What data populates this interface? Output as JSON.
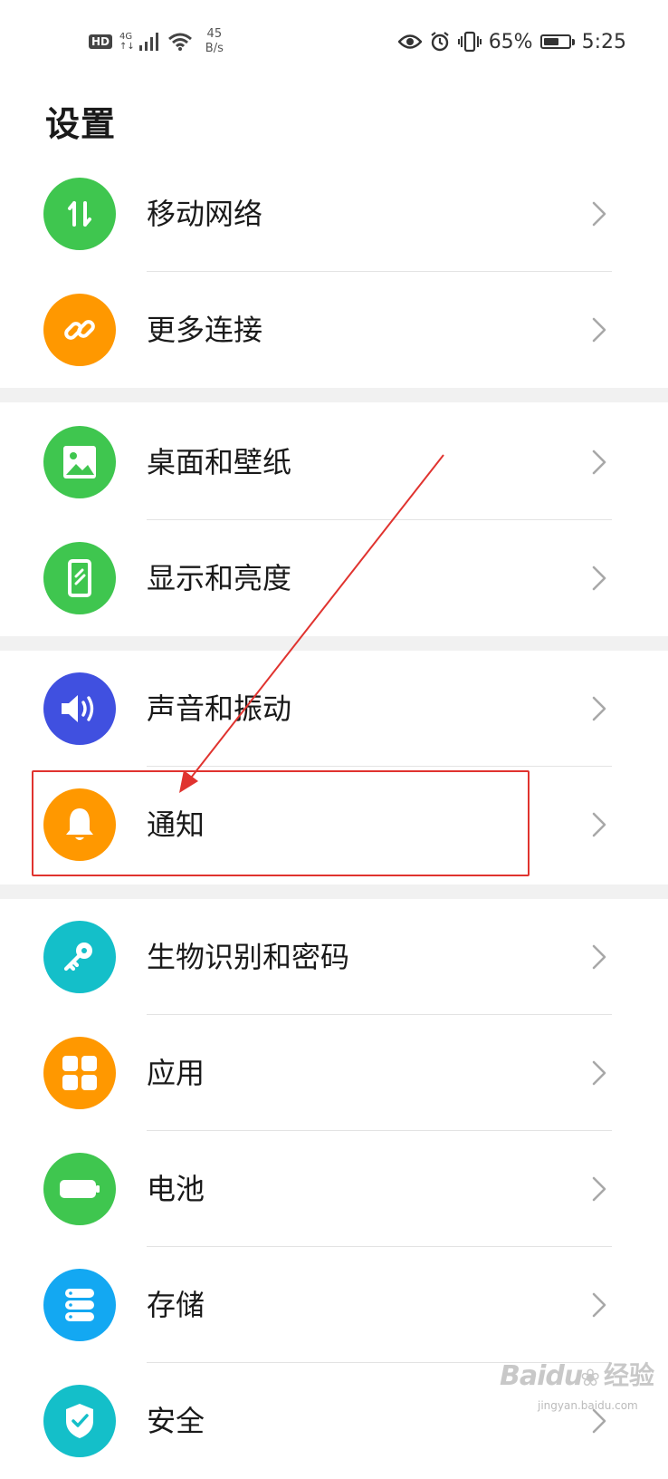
{
  "status_bar": {
    "hd": "HD",
    "net": "4G",
    "net_sub": "↑↓",
    "speed_value": "45",
    "speed_unit": "B/s",
    "battery_percent": "65%",
    "battery_level": 0.65,
    "time": "5:25"
  },
  "title": "设置",
  "items": [
    {
      "label": "移动网络",
      "icon": "mobile-data-icon",
      "color": "#3fc64f"
    },
    {
      "label": "更多连接",
      "icon": "link-icon",
      "color": "#ff9800"
    },
    {
      "label": "桌面和壁纸",
      "icon": "wallpaper-icon",
      "color": "#3fc64f"
    },
    {
      "label": "显示和亮度",
      "icon": "display-icon",
      "color": "#3fc64f"
    },
    {
      "label": "声音和振动",
      "icon": "sound-icon",
      "color": "#4050e0"
    },
    {
      "label": "通知",
      "icon": "bell-icon",
      "color": "#ff9800"
    },
    {
      "label": "生物识别和密码",
      "icon": "key-icon",
      "color": "#14bfc9"
    },
    {
      "label": "应用",
      "icon": "apps-grid-icon",
      "color": "#ff9800"
    },
    {
      "label": "电池",
      "icon": "battery-icon",
      "color": "#3fc64f"
    },
    {
      "label": "存储",
      "icon": "storage-icon",
      "color": "#13a8f2"
    },
    {
      "label": "安全",
      "icon": "shield-icon",
      "color": "#14bfc9"
    }
  ],
  "watermark": {
    "brand": "Baidu",
    "product": "经验",
    "url": "jingyan.baidu.com"
  }
}
